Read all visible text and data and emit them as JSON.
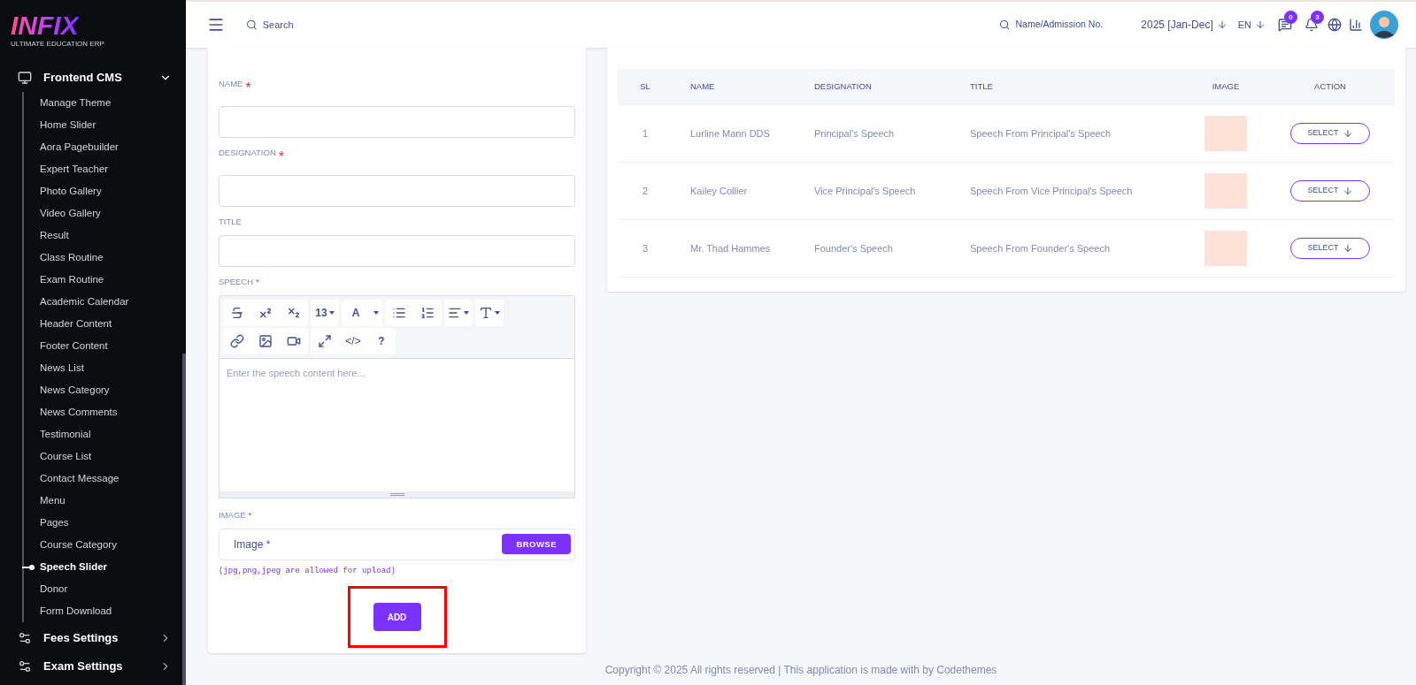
{
  "sidebar": {
    "logo": {
      "mark": "INFIX",
      "tagline": "ULTIMATE EDUCATION ERP"
    },
    "sections": [
      {
        "label": "Frontend CMS",
        "kind": "cms",
        "expanded": true,
        "children": [
          {
            "label": "Manage Theme",
            "selected": false
          },
          {
            "label": "Home Slider",
            "selected": false
          },
          {
            "label": "Aora Pagebuilder",
            "selected": false
          },
          {
            "label": "Expert Teacher",
            "selected": false
          },
          {
            "label": "Photo Gallery",
            "selected": false
          },
          {
            "label": "Video Gallery",
            "selected": false
          },
          {
            "label": "Result",
            "selected": false
          },
          {
            "label": "Class Routine",
            "selected": false
          },
          {
            "label": "Exam Routine",
            "selected": false
          },
          {
            "label": "Academic Calendar",
            "selected": false
          },
          {
            "label": "Header Content",
            "selected": false
          },
          {
            "label": "Footer Content",
            "selected": false
          },
          {
            "label": "News List",
            "selected": false
          },
          {
            "label": "News Category",
            "selected": false
          },
          {
            "label": "News Comments",
            "selected": false
          },
          {
            "label": "Testimonial",
            "selected": false
          },
          {
            "label": "Course List",
            "selected": false
          },
          {
            "label": "Contact Message",
            "selected": false
          },
          {
            "label": "Menu",
            "selected": false
          },
          {
            "label": "Pages",
            "selected": false
          },
          {
            "label": "Course Category",
            "selected": false
          },
          {
            "label": "Speech Slider",
            "selected": true
          },
          {
            "label": "Donor",
            "selected": false
          },
          {
            "label": "Form Download",
            "selected": false
          }
        ]
      },
      {
        "label": "Fees Settings",
        "kind": "settings",
        "expanded": false
      },
      {
        "label": "Exam Settings",
        "kind": "settings",
        "expanded": false
      }
    ]
  },
  "header": {
    "search": {
      "placeholder": "Search"
    },
    "student_search": {
      "placeholder": "Name/Admission No."
    },
    "session": "2025 [Jan-Dec]",
    "language": "EN",
    "messages_badge": "0",
    "notifications_badge": "3"
  },
  "form": {
    "fields": [
      {
        "label": "NAME",
        "required_mark": "*"
      },
      {
        "label": "DESIGNATION",
        "required_mark": "*"
      },
      {
        "label": "TITLE"
      }
    ],
    "speech": {
      "label": "SPEECH",
      "required_mark": "*",
      "placeholder": "Enter the speech content here...",
      "toolbar": [
        [
          [
            {
              "kind": "strikethrough"
            },
            {
              "kind": "superscript"
            },
            {
              "kind": "subscript"
            }
          ],
          [
            {
              "kind": "text",
              "label": "13",
              "caret": true
            }
          ],
          [
            {
              "kind": "text",
              "label": "A",
              "caret": false
            },
            {
              "kind": "caret"
            }
          ],
          [
            {
              "kind": "bullets"
            },
            {
              "kind": "numbers"
            }
          ],
          [
            {
              "kind": "align",
              "caret": true
            }
          ],
          [
            {
              "kind": "textsize",
              "caret": true
            }
          ]
        ],
        [
          [
            {
              "kind": "link"
            },
            {
              "kind": "image"
            },
            {
              "kind": "video"
            }
          ],
          [
            {
              "kind": "fullscreen"
            },
            {
              "kind": "text",
              "label": "</>",
              "caret": false
            },
            {
              "kind": "text",
              "label": "?",
              "caret": false
            }
          ]
        ]
      ]
    },
    "image": {
      "label": "IMAGE",
      "required_mark": "*",
      "placeholder": "Image *",
      "browse": "BROWSE",
      "hint": "(jpg,png,jpeg are allowed for upload)"
    },
    "add_button": {
      "label": "ADD",
      "highlighted": true
    }
  },
  "table": {
    "columns": [
      "SL",
      "NAME",
      "DESIGNATION",
      "TITLE",
      "IMAGE",
      "ACTION"
    ],
    "rows": [
      {
        "sl": "1",
        "name": "Lurline Mann DDS",
        "designation": "Principal's Speech",
        "title": "Speech From Principal's Speech",
        "action": "SELECT"
      },
      {
        "sl": "2",
        "name": "Kailey Collier",
        "designation": "Vice Principal's Speech",
        "title": "Speech From Vice Principal's Speech",
        "action": "SELECT"
      },
      {
        "sl": "3",
        "name": "Mr. Thad Hammes",
        "designation": "Founder's Speech",
        "title": "Speech From Founder's Speech",
        "action": "SELECT"
      }
    ]
  },
  "footer": "Copyright © 2025 All rights reserved | This application is made with by Codethemes"
}
